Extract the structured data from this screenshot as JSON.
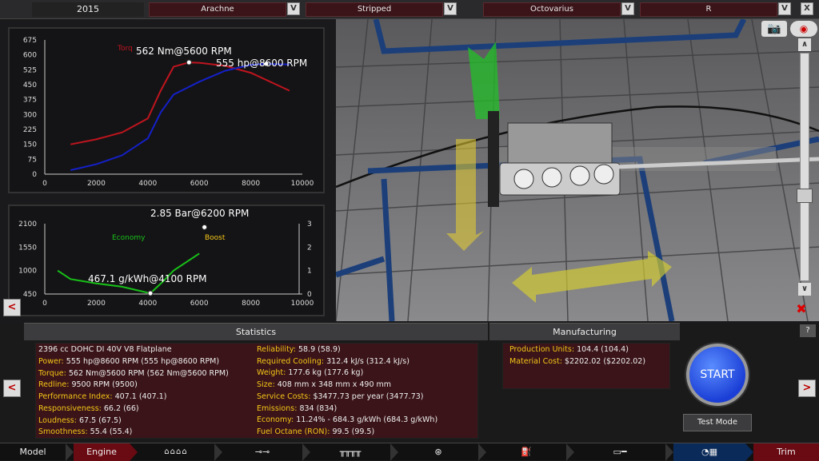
{
  "topbar": {
    "year": "2015",
    "family": "Arachne",
    "variant": "Stripped",
    "car": "Octovarius",
    "trim": "R",
    "dropdown_glyph": "V",
    "close_glyph": "X"
  },
  "torque_chart": {
    "power_peak": "555 hp@8600 RPM",
    "torque_peak": "562 Nm@5600 RPM",
    "torque_legend_fragment": "Torq",
    "y_ticks": [
      "675",
      "600",
      "525",
      "450",
      "375",
      "300",
      "225",
      "150",
      "75",
      "0"
    ],
    "x_ticks": [
      "0",
      "2000",
      "4000",
      "6000",
      "8000",
      "10000"
    ]
  },
  "economy_chart": {
    "boost_peak": "2.85 Bar@6200 RPM",
    "economy_peak": "467.1 g/kWh@4100 RPM",
    "economy_label": "Economy",
    "boost_label": "Boost",
    "y_left_ticks": [
      "2100",
      "1550",
      "1000",
      "450"
    ],
    "y_right_ticks": [
      "3",
      "2",
      "1",
      "0"
    ],
    "x_ticks": [
      "0",
      "2000",
      "4000",
      "6000",
      "8000",
      "10000"
    ]
  },
  "chart_data": [
    {
      "type": "line",
      "xlim": [
        0,
        10000
      ],
      "ylim": [
        0,
        675
      ],
      "series": [
        {
          "x": [
            1000,
            2000,
            3000,
            4000,
            4500,
            5000,
            5600,
            6000,
            7000,
            8000,
            9000,
            9500
          ],
          "y": [
            150,
            175,
            210,
            280,
            420,
            540,
            562,
            560,
            545,
            510,
            450,
            420
          ]
        },
        {
          "x": [
            1000,
            2000,
            3000,
            4000,
            4500,
            5000,
            6000,
            7000,
            8000,
            8600,
            9000,
            9500
          ],
          "y": [
            20,
            50,
            95,
            180,
            310,
            400,
            465,
            520,
            550,
            555,
            553,
            552
          ]
        }
      ],
      "annotations": [
        {
          "text": "562 Nm@5600 RPM",
          "x": 5600,
          "y": 562
        },
        {
          "text": "555 hp@8600 RPM",
          "x": 8600,
          "y": 555
        }
      ]
    },
    {
      "type": "line",
      "xlim": [
        0,
        10000
      ],
      "ylim": [
        450,
        2100
      ],
      "y2lim": [
        0,
        3
      ],
      "series": [
        {
          "name": "Economy",
          "x": [
            500,
            1000,
            2000,
            3000,
            4000,
            4100,
            4600,
            5000,
            6000
          ],
          "y": [
            1000,
            800,
            700,
            620,
            480,
            467,
            750,
            1000,
            1400
          ]
        },
        {
          "name": "Boost",
          "axis": "right",
          "x": [
            6200
          ],
          "y": [
            2.85
          ]
        }
      ],
      "annotations": [
        {
          "text": "2.85 Bar@6200 RPM",
          "x": 6200,
          "y": 2.85
        },
        {
          "text": "467.1 g/kWh@4100 RPM",
          "x": 4100,
          "y": 467.1
        }
      ]
    }
  ],
  "statistics": {
    "title": "Statistics",
    "engine_desc": "2396 cc DOHC DI 40V V8 Flatplane",
    "left": [
      {
        "k": "Power:",
        "v": "555 hp@8600 RPM (555 hp@8600 RPM)"
      },
      {
        "k": "Torque:",
        "v": "562 Nm@5600 RPM (562 Nm@5600 RPM)"
      },
      {
        "k": "Redline:",
        "v": "9500 RPM (9500)"
      },
      {
        "k": "Performance Index:",
        "v": "407.1 (407.1)"
      },
      {
        "k": "Responsiveness:",
        "v": "66.2 (66)"
      },
      {
        "k": "Loudness:",
        "v": "67.5 (67.5)"
      },
      {
        "k": "Smoothness:",
        "v": "55.4 (55.4)"
      }
    ],
    "right": [
      {
        "k": "Reliability:",
        "v": "58.9 (58.9)"
      },
      {
        "k": "Required Cooling:",
        "v": "312.4 kJ/s (312.4 kJ/s)"
      },
      {
        "k": "Weight:",
        "v": "177.6 kg (177.6 kg)"
      },
      {
        "k": "Size:",
        "v": "408 mm x 348 mm x 490 mm"
      },
      {
        "k": "Service Costs:",
        "v": "$3477.73 per year (3477.73)"
      },
      {
        "k": "Emissions:",
        "v": "834 (834)"
      },
      {
        "k": "Economy:",
        "v": "11.24% - 684.3 g/kWh (684.3 g/kWh)"
      },
      {
        "k": "Fuel Octane (RON):",
        "v": "99.5 (99.5)"
      }
    ]
  },
  "manufacturing": {
    "title": "Manufacturing",
    "rows": [
      {
        "k": "Production Units:",
        "v": "104.4 (104.4)"
      },
      {
        "k": "Material Cost:",
        "v": "$2202.02 ($2202.02)"
      }
    ]
  },
  "help_label": "?",
  "start_label": "START",
  "test_mode_label": "Test Mode",
  "nav": {
    "model": "Model",
    "engine": "Engine",
    "trim": "Trim"
  },
  "colors": {
    "torque": "#c0141e",
    "power": "#1420c8",
    "economy": "#18c018",
    "accent_yellow": "#f5c518",
    "start_blue": "#1b3fd6"
  }
}
